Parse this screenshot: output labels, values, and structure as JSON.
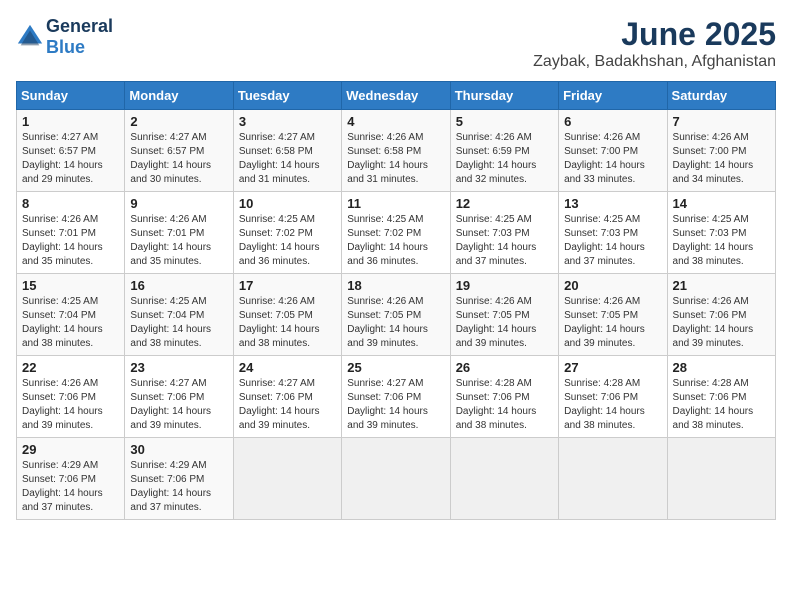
{
  "header": {
    "logo_general": "General",
    "logo_blue": "Blue",
    "month": "June 2025",
    "location": "Zaybak, Badakhshan, Afghanistan"
  },
  "weekdays": [
    "Sunday",
    "Monday",
    "Tuesday",
    "Wednesday",
    "Thursday",
    "Friday",
    "Saturday"
  ],
  "weeks": [
    [
      {
        "day": "1",
        "sunrise": "4:27 AM",
        "sunset": "6:57 PM",
        "daylight": "14 hours and 29 minutes."
      },
      {
        "day": "2",
        "sunrise": "4:27 AM",
        "sunset": "6:57 PM",
        "daylight": "14 hours and 30 minutes."
      },
      {
        "day": "3",
        "sunrise": "4:27 AM",
        "sunset": "6:58 PM",
        "daylight": "14 hours and 31 minutes."
      },
      {
        "day": "4",
        "sunrise": "4:26 AM",
        "sunset": "6:58 PM",
        "daylight": "14 hours and 31 minutes."
      },
      {
        "day": "5",
        "sunrise": "4:26 AM",
        "sunset": "6:59 PM",
        "daylight": "14 hours and 32 minutes."
      },
      {
        "day": "6",
        "sunrise": "4:26 AM",
        "sunset": "7:00 PM",
        "daylight": "14 hours and 33 minutes."
      },
      {
        "day": "7",
        "sunrise": "4:26 AM",
        "sunset": "7:00 PM",
        "daylight": "14 hours and 34 minutes."
      }
    ],
    [
      {
        "day": "8",
        "sunrise": "4:26 AM",
        "sunset": "7:01 PM",
        "daylight": "14 hours and 35 minutes."
      },
      {
        "day": "9",
        "sunrise": "4:26 AM",
        "sunset": "7:01 PM",
        "daylight": "14 hours and 35 minutes."
      },
      {
        "day": "10",
        "sunrise": "4:25 AM",
        "sunset": "7:02 PM",
        "daylight": "14 hours and 36 minutes."
      },
      {
        "day": "11",
        "sunrise": "4:25 AM",
        "sunset": "7:02 PM",
        "daylight": "14 hours and 36 minutes."
      },
      {
        "day": "12",
        "sunrise": "4:25 AM",
        "sunset": "7:03 PM",
        "daylight": "14 hours and 37 minutes."
      },
      {
        "day": "13",
        "sunrise": "4:25 AM",
        "sunset": "7:03 PM",
        "daylight": "14 hours and 37 minutes."
      },
      {
        "day": "14",
        "sunrise": "4:25 AM",
        "sunset": "7:03 PM",
        "daylight": "14 hours and 38 minutes."
      }
    ],
    [
      {
        "day": "15",
        "sunrise": "4:25 AM",
        "sunset": "7:04 PM",
        "daylight": "14 hours and 38 minutes."
      },
      {
        "day": "16",
        "sunrise": "4:25 AM",
        "sunset": "7:04 PM",
        "daylight": "14 hours and 38 minutes."
      },
      {
        "day": "17",
        "sunrise": "4:26 AM",
        "sunset": "7:05 PM",
        "daylight": "14 hours and 38 minutes."
      },
      {
        "day": "18",
        "sunrise": "4:26 AM",
        "sunset": "7:05 PM",
        "daylight": "14 hours and 39 minutes."
      },
      {
        "day": "19",
        "sunrise": "4:26 AM",
        "sunset": "7:05 PM",
        "daylight": "14 hours and 39 minutes."
      },
      {
        "day": "20",
        "sunrise": "4:26 AM",
        "sunset": "7:05 PM",
        "daylight": "14 hours and 39 minutes."
      },
      {
        "day": "21",
        "sunrise": "4:26 AM",
        "sunset": "7:06 PM",
        "daylight": "14 hours and 39 minutes."
      }
    ],
    [
      {
        "day": "22",
        "sunrise": "4:26 AM",
        "sunset": "7:06 PM",
        "daylight": "14 hours and 39 minutes."
      },
      {
        "day": "23",
        "sunrise": "4:27 AM",
        "sunset": "7:06 PM",
        "daylight": "14 hours and 39 minutes."
      },
      {
        "day": "24",
        "sunrise": "4:27 AM",
        "sunset": "7:06 PM",
        "daylight": "14 hours and 39 minutes."
      },
      {
        "day": "25",
        "sunrise": "4:27 AM",
        "sunset": "7:06 PM",
        "daylight": "14 hours and 39 minutes."
      },
      {
        "day": "26",
        "sunrise": "4:28 AM",
        "sunset": "7:06 PM",
        "daylight": "14 hours and 38 minutes."
      },
      {
        "day": "27",
        "sunrise": "4:28 AM",
        "sunset": "7:06 PM",
        "daylight": "14 hours and 38 minutes."
      },
      {
        "day": "28",
        "sunrise": "4:28 AM",
        "sunset": "7:06 PM",
        "daylight": "14 hours and 38 minutes."
      }
    ],
    [
      {
        "day": "29",
        "sunrise": "4:29 AM",
        "sunset": "7:06 PM",
        "daylight": "14 hours and 37 minutes."
      },
      {
        "day": "30",
        "sunrise": "4:29 AM",
        "sunset": "7:06 PM",
        "daylight": "14 hours and 37 minutes."
      },
      null,
      null,
      null,
      null,
      null
    ]
  ]
}
